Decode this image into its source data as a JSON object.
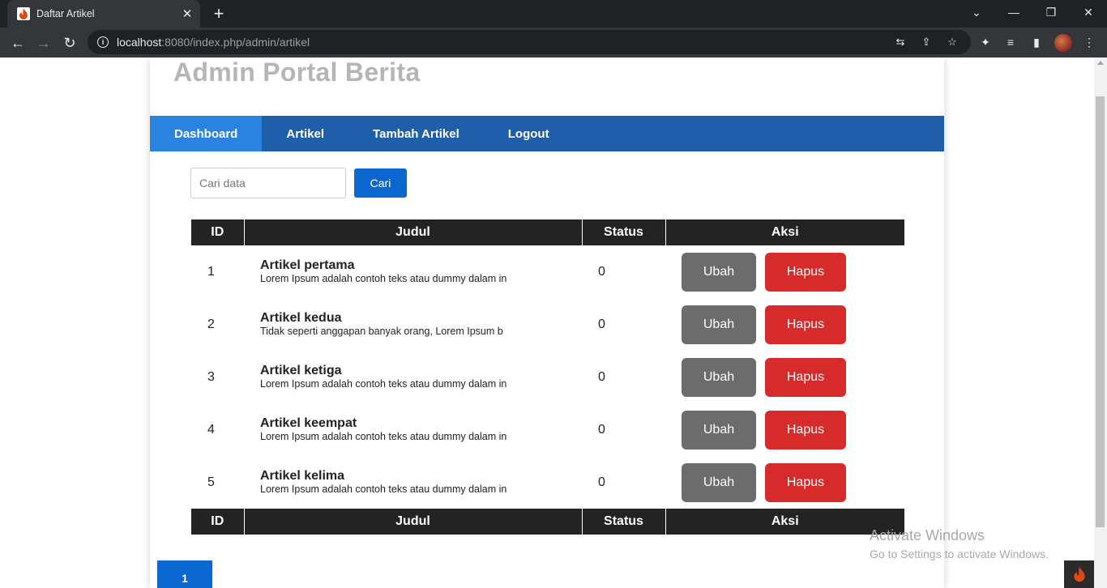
{
  "browser": {
    "tab_title": "Daftar Artikel",
    "url_host": "localhost",
    "url_rest": ":8080/index.php/admin/artikel"
  },
  "site": {
    "title": "Admin Portal Berita",
    "nav": [
      "Dashboard",
      "Artikel",
      "Tambah Artikel",
      "Logout"
    ]
  },
  "search": {
    "placeholder": "Cari data",
    "button": "Cari"
  },
  "table": {
    "headers": [
      "ID",
      "Judul",
      "Status",
      "Aksi"
    ],
    "rows": [
      {
        "id": "1",
        "title": "Artikel pertama",
        "excerpt": "Lorem Ipsum adalah contoh teks atau dummy dalam in",
        "status": "0"
      },
      {
        "id": "2",
        "title": "Artikel kedua",
        "excerpt": "Tidak seperti anggapan banyak orang, Lorem Ipsum b",
        "status": "0"
      },
      {
        "id": "3",
        "title": "Artikel ketiga",
        "excerpt": "Lorem Ipsum adalah contoh teks atau dummy dalam in",
        "status": "0"
      },
      {
        "id": "4",
        "title": "Artikel keempat",
        "excerpt": "Lorem Ipsum adalah contoh teks atau dummy dalam in",
        "status": "0"
      },
      {
        "id": "5",
        "title": "Artikel kelima",
        "excerpt": "Lorem Ipsum adalah contoh teks atau dummy dalam in",
        "status": "0"
      }
    ],
    "edit_label": "Ubah",
    "delete_label": "Hapus"
  },
  "pagination": {
    "current": "1"
  },
  "watermark": {
    "line1": "Activate Windows",
    "line2": "Go to Settings to activate Windows."
  },
  "colors": {
    "nav_bg": "#1f5faa",
    "nav_active": "#2b83e0",
    "primary": "#0a67d0",
    "edit": "#6c6c6c",
    "delete": "#d72a2a",
    "table_header": "#232323"
  }
}
